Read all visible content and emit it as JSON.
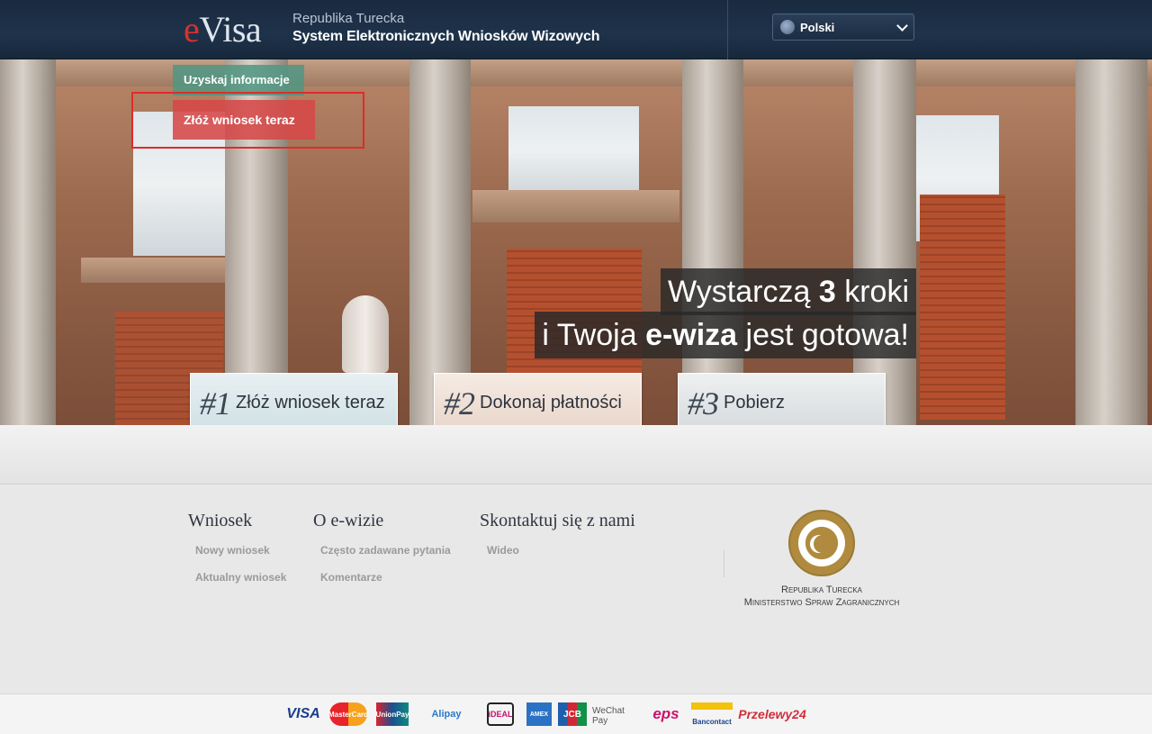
{
  "header": {
    "logo_e": "e",
    "logo_visa": "Visa",
    "subtitle_line1": "Republika Turecka",
    "subtitle_line2": "System Elektronicznych Wniosków Wizowych",
    "language": "Polski"
  },
  "hero": {
    "nav_info": "Uzyskaj informacje",
    "nav_apply": "Złóż wniosek teraz",
    "headline_line1_a": "Wystarczą ",
    "headline_line1_b": "3",
    "headline_line1_c": " kroki",
    "headline_line2_a": "i Twoja ",
    "headline_line2_b": "e-wiza",
    "headline_line2_c": " jest gotowa!",
    "steps": [
      {
        "num": "#1",
        "label": "Złóż wniosek teraz"
      },
      {
        "num": "#2",
        "label": "Dokonaj płatności"
      },
      {
        "num": "#3",
        "label": "Pobierz"
      }
    ]
  },
  "footer": {
    "col1": {
      "title": "Wniosek",
      "links": [
        "Nowy wniosek",
        "Aktualny wniosek"
      ]
    },
    "col2": {
      "title": "O e-wizie",
      "links": [
        "Często zadawane pytania",
        "Komentarze"
      ]
    },
    "col3": {
      "title": "Skontaktuj się z nami",
      "links": [
        "Wideo"
      ]
    },
    "ministry_line1": "Republika Turecka",
    "ministry_line2": "Ministerstwo Spraw Zagranicznych"
  },
  "payments": {
    "visa": "VISA",
    "mastercard": "MasterCard",
    "unionpay": "UnionPay",
    "alipay": "Alipay",
    "ideal": "iDEAL",
    "amex": "AMEX",
    "jcb": "JCB",
    "wechat": "WeChat Pay",
    "eps": "eps",
    "bancontact": "Bancontact",
    "przelewy": "Przelewy24"
  }
}
